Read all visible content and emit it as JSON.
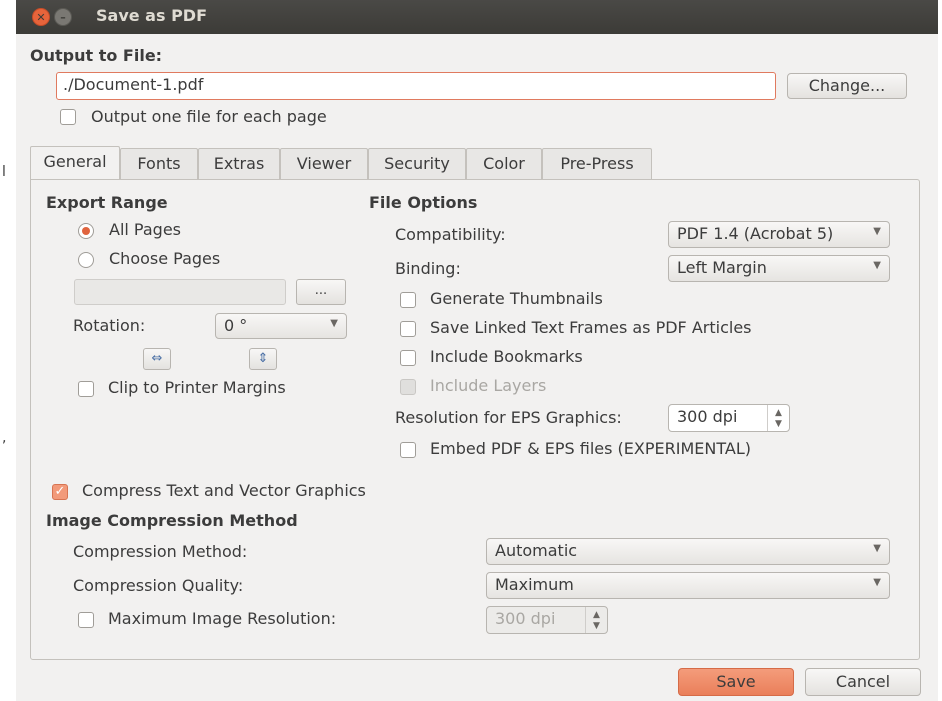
{
  "window": {
    "title": "Save as PDF"
  },
  "stray": [
    "l",
    ","
  ],
  "output": {
    "label": "Output to File:",
    "file_value": "./Document-1.pdf",
    "change_button": "Change...",
    "one_file_per_page_label": "Output one file for each page",
    "one_file_per_page_checked": false
  },
  "tabs": [
    "General",
    "Fonts",
    "Extras",
    "Viewer",
    "Security",
    "Color",
    "Pre-Press"
  ],
  "active_tab": "General",
  "export_range": {
    "title": "Export Range",
    "all_pages_label": "All Pages",
    "choose_pages_label": "Choose Pages",
    "selected": "All Pages",
    "browse_button": "...",
    "rotation_label": "Rotation:",
    "rotation_value": "0 °",
    "clip_label": "Clip to Printer Margins",
    "clip_checked": false
  },
  "file_options": {
    "title": "File Options",
    "compatibility_label": "Compatibility:",
    "compatibility_value": "PDF 1.4 (Acrobat 5)",
    "binding_label": "Binding:",
    "binding_value": "Left Margin",
    "generate_thumbnails_label": "Generate Thumbnails",
    "save_linked_label": "Save Linked Text Frames as PDF Articles",
    "include_bookmarks_label": "Include Bookmarks",
    "include_layers_label": "Include Layers",
    "resolution_label": "Resolution for EPS Graphics:",
    "resolution_value": "300 dpi",
    "embed_label": "Embed PDF & EPS files (EXPERIMENTAL)"
  },
  "compress": {
    "label": "Compress Text and Vector Graphics",
    "checked": true
  },
  "image_compression": {
    "title": "Image Compression Method",
    "method_label": "Compression Method:",
    "method_value": "Automatic",
    "quality_label": "Compression Quality:",
    "quality_value": "Maximum",
    "max_res_label": "Maximum Image Resolution:",
    "max_res_value": "300 dpi"
  },
  "footer": {
    "save_button": "Save",
    "cancel_button": "Cancel"
  },
  "colors": {
    "accent": "#e0643e",
    "titlebar": "#3c3b37",
    "window_bg": "#f2f1f0"
  }
}
